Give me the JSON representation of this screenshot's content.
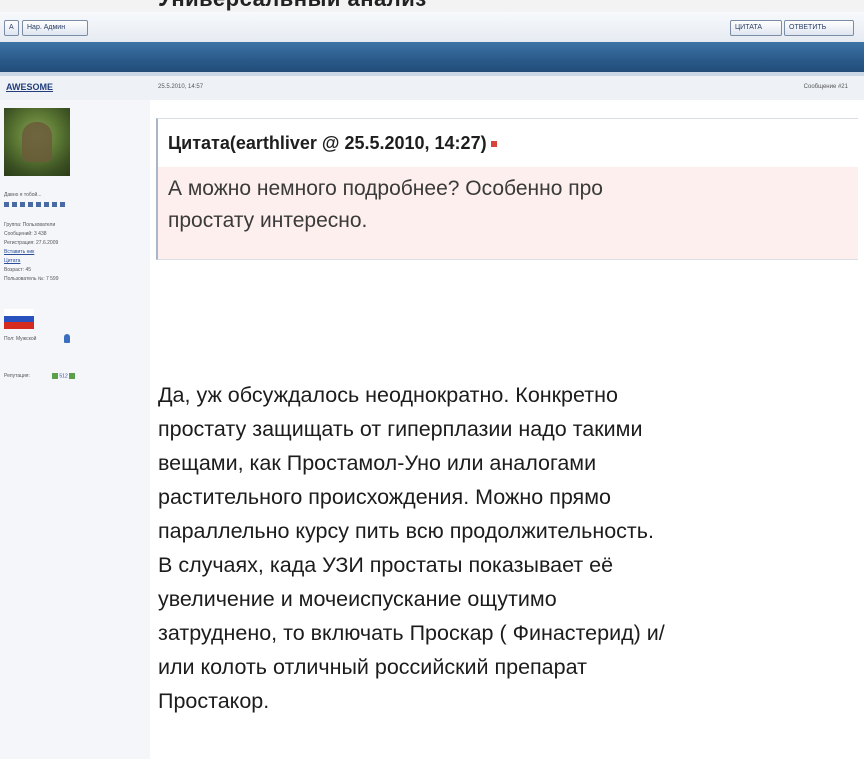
{
  "page": {
    "top_cut_title": "Универсальный анализ",
    "toolbar": {
      "left_btn1": "A",
      "left_btn2": "Нар. Админ",
      "right_btn1": "ЦИТАТА",
      "right_btn2": "ОТВЕТИТЬ"
    }
  },
  "post": {
    "author": "AWESOME",
    "date": "25.5.2010, 14:57",
    "post_number": "Сообщение #21"
  },
  "sidebar": {
    "online_label": "Давно я тобой...",
    "group": "Группа: Пользователи",
    "messages": "Сообщений: 3 438",
    "registration": "Регистрация: 27.6.2009",
    "link1": "Вставить ник",
    "link2": "Цитата",
    "age": "Возраст: 45",
    "user_number": "Пользователь №: 7 599",
    "gender": "Пол: Мужской",
    "reputation_label": "Репутация:",
    "reputation_value": "512"
  },
  "quote": {
    "header": "Цитата(earthliver @ 25.5.2010, 14:27)",
    "lines": [
      "А можно немного подробнее? Особенно про",
      "простату интересно."
    ]
  },
  "reply": {
    "lines": [
      "Да, уж обсуждалось неоднократно. Конкретно",
      "простату защищать от гиперплазии надо такими",
      "вещами, как Простамол-Уно или аналогами",
      "растительного происхождения. Можно прямо",
      "параллельно курсу пить всю продолжительность.",
      "В случаях, када УЗИ простаты показывает её",
      "увеличение и мочеиспускание ощутимо",
      "затруднено, то включать Проскар ( Финастерид) и/",
      "или колоть отличный российский препарат",
      "Простакор."
    ]
  },
  "colors": {
    "band": "#2a5a8a",
    "quote_bg": "#fcefed",
    "link": "#2a4d9a"
  },
  "flag_colors": [
    "#ffffff",
    "#2a52be",
    "#d52b1e"
  ]
}
